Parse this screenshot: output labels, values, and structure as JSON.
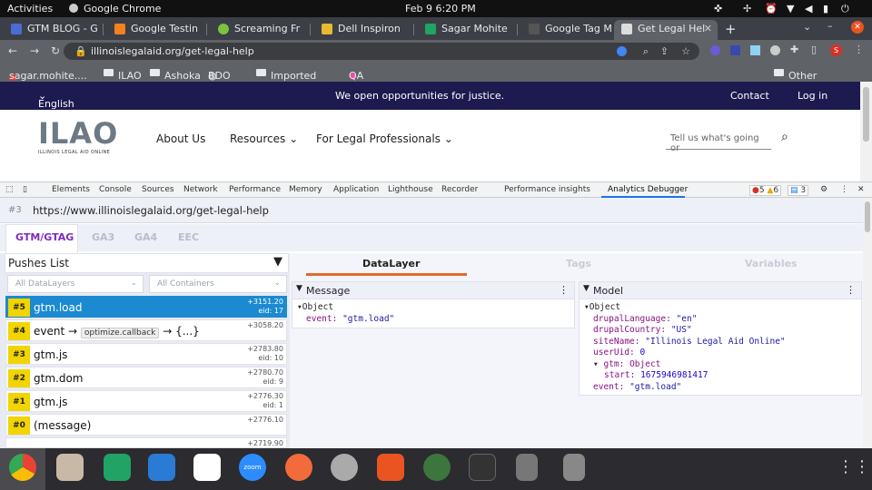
{
  "system": {
    "activities": "Activities",
    "app": "Google Chrome",
    "datetime": "Feb 9  6:20 PM"
  },
  "tabs": [
    {
      "label": "GTM BLOG - G",
      "color": "#4a6cd4"
    },
    {
      "label": "Google Testin",
      "color": "#f48120"
    },
    {
      "label": "Screaming Fr",
      "color": "#7cc140"
    },
    {
      "label": "Dell Inspiron",
      "color": "#e8b931"
    },
    {
      "label": "Sagar Mohite",
      "color": "#1fa463"
    },
    {
      "label": "Google Tag M",
      "color": "#555555"
    },
    {
      "label": "Get Legal Hel",
      "color": "#dddddd"
    }
  ],
  "new_tab": "+",
  "omnibox": {
    "url": "illinoislegalaid.org/get-legal-help"
  },
  "bookmarks": [
    "sagar.mohite....",
    "ILAO",
    "Ashoka",
    "BDO",
    "Imported Fro...",
    "QA Portal"
  ],
  "other_bookmarks": "Other bookmarks",
  "site": {
    "language": "English",
    "tagline": "We open opportunities for justice.",
    "contact": "Contact",
    "login": "Log in",
    "logo_text": "ILAO",
    "logo_sub": "ILLINOIS LEGAL AID ONLINE",
    "nav": [
      "About Us",
      "Resources",
      "For Legal Professionals"
    ],
    "search_placeholder": "Tell us what's going or"
  },
  "devtools": {
    "tabs": [
      "Elements",
      "Console",
      "Sources",
      "Network",
      "Performance",
      "Memory",
      "Application",
      "Lighthouse",
      "Recorder",
      "Performance insights",
      "Analytics Debugger"
    ],
    "errors": "5",
    "warnings": "6",
    "messages": "3"
  },
  "debugger": {
    "hit_id": "#3",
    "page_url": "https://www.illinoislegalaid.org/get-legal-help",
    "source_tabs": [
      "GTM/GTAG",
      "GA3",
      "GA4",
      "EEC"
    ],
    "pushes_title": "Pushes List",
    "filter_layers": "All DataLayers",
    "filter_containers": "All Containers",
    "pushes": [
      {
        "num": "#5",
        "label": "gtm.load",
        "time": "+3151.20",
        "eid": "eid: 17"
      },
      {
        "num": "#4",
        "label": "event →",
        "pill": "optimize.callback",
        "tail": "→ {...}",
        "time": "+3058.20",
        "eid": ""
      },
      {
        "num": "#3",
        "label": "gtm.js",
        "time": "+2783.80",
        "eid": "eid: 10"
      },
      {
        "num": "#2",
        "label": "gtm.dom",
        "time": "+2780.70",
        "eid": "eid: 9"
      },
      {
        "num": "#1",
        "label": "gtm.js",
        "time": "+2776.30",
        "eid": "eid: 1"
      },
      {
        "num": "#0",
        "label": "(message)",
        "time": "+2776.10",
        "eid": ""
      }
    ],
    "partial_time": "+2719.90",
    "panel_tabs": [
      "DataLayer",
      "Tags",
      "Variables"
    ],
    "message_title": "Message",
    "model_title": "Model",
    "message_obj": "Object",
    "message_event_key": "event:",
    "message_event_val": "\"gtm.load\"",
    "model": {
      "root": "Object",
      "drupalLanguage": "\"en\"",
      "drupalCountry": "\"US\"",
      "siteName": "\"Illinois Legal Aid Online\"",
      "userUid": "0",
      "gtm_label": "gtm: Object",
      "start": "1675946981417",
      "event": "\"gtm.load\""
    }
  },
  "colors": {
    "brand_navy": "#1d1a4f",
    "selected_row": "#1c8ad0",
    "badge": "#f1d400",
    "active_tab": "#7b2cbf",
    "underline": "#e06a2a"
  }
}
